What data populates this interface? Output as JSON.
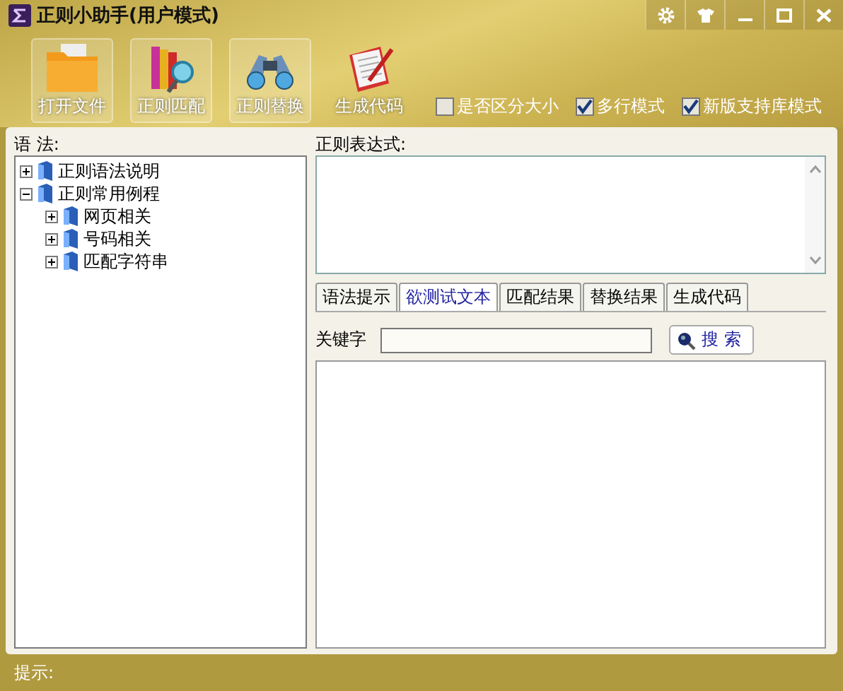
{
  "window": {
    "title": "正则小助手(用户模式)"
  },
  "toolbar": [
    {
      "label": "打开文件",
      "kind": "folder",
      "selected": true
    },
    {
      "label": "正则匹配",
      "kind": "books",
      "selected": true
    },
    {
      "label": "正则替换",
      "kind": "binoculars",
      "selected": true
    },
    {
      "label": "生成代码",
      "kind": "notepad",
      "selected": false
    }
  ],
  "options": [
    {
      "label": "是否区分大小",
      "checked": false
    },
    {
      "label": "多行模式",
      "checked": true
    },
    {
      "label": "新版支持库模式",
      "checked": true
    }
  ],
  "syntax_panel": {
    "label": "语 法:",
    "tree": [
      {
        "label": "正则语法说明",
        "expanded": false
      },
      {
        "label": "正则常用例程",
        "expanded": true,
        "children": [
          {
            "label": "网页相关",
            "expanded": false
          },
          {
            "label": "号码相关",
            "expanded": false
          },
          {
            "label": "匹配字符串",
            "expanded": false
          }
        ]
      }
    ]
  },
  "regex_panel": {
    "label": "正则表达式:"
  },
  "tabs": [
    {
      "label": "语法提示",
      "selected": false
    },
    {
      "label": "欲测试文本",
      "selected": true
    },
    {
      "label": "匹配结果",
      "selected": false
    },
    {
      "label": "替换结果",
      "selected": false
    },
    {
      "label": "生成代码",
      "selected": false
    }
  ],
  "keyword": {
    "label": "关键字",
    "button": "搜 索"
  },
  "status_bar": {
    "label": "提示:"
  }
}
